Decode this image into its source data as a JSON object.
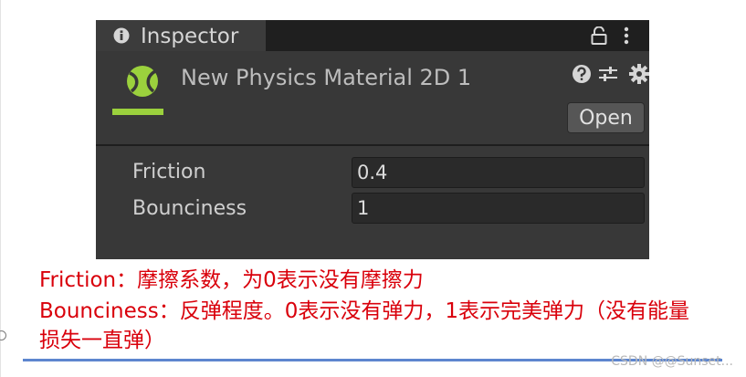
{
  "inspector": {
    "tab_label": "Inspector",
    "asset_name": "New Physics Material 2D 1",
    "open_button_label": "Open",
    "properties": [
      {
        "label": "Friction",
        "value": "0.4"
      },
      {
        "label": "Bounciness",
        "value": "1"
      }
    ],
    "icons": [
      "info-icon",
      "lock-icon",
      "more-menu-icon",
      "physics-material-icon",
      "help-icon",
      "preset-icon",
      "gear-icon"
    ],
    "colors": {
      "panel": "#383838",
      "accent": "#9bd13d"
    }
  },
  "notes": {
    "line1": "Friction：摩擦系数，为0表示没有摩擦力",
    "line2": "Bounciness：反弹程度。0表示没有弹力，1表示完美弹力（没有能量",
    "line3": "损失一直弹）",
    "color": "#d9000b"
  },
  "watermark": "CSDN @@Sunset..."
}
